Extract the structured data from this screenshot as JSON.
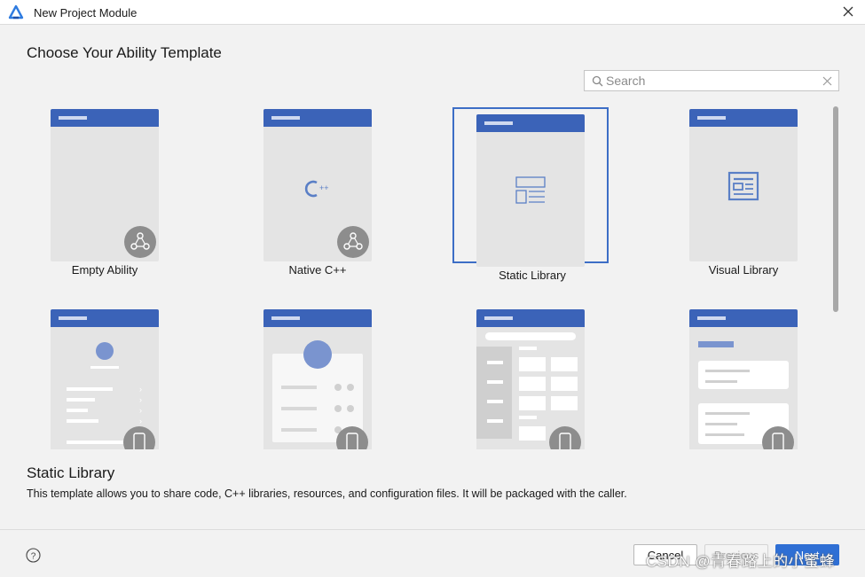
{
  "window": {
    "title": "New Project Module",
    "close_icon": "close-icon"
  },
  "page": {
    "title": "Choose Your Ability Template"
  },
  "search": {
    "value": "",
    "placeholder": "Search",
    "icon": "search-icon",
    "clear_icon": "clear-icon"
  },
  "templates": [
    {
      "label": "Empty Ability",
      "icon": "ability-badge-icon",
      "selected": false
    },
    {
      "label": "Native C++",
      "icon": "cpp-icon",
      "selected": false
    },
    {
      "label": "Static Library",
      "icon": "library-layout-icon",
      "selected": true
    },
    {
      "label": "Visual Library",
      "icon": "visual-card-icon",
      "selected": false
    },
    {
      "label": "",
      "icon": "profile-list-template",
      "selected": false
    },
    {
      "label": "",
      "icon": "avatar-card-template",
      "selected": false
    },
    {
      "label": "",
      "icon": "sidebar-grid-template",
      "selected": false
    },
    {
      "label": "",
      "icon": "card-list-template",
      "selected": false
    }
  ],
  "description": {
    "title": "Static Library",
    "text": "This template allows you to share code, C++ libraries, resources, and configuration files. It will be packaged with the caller."
  },
  "footer": {
    "help_icon": "help-icon",
    "cancel_label": "Cancel",
    "previous_label": "Previous",
    "next_label": "Next"
  },
  "watermark": "CSDN @青春路上的小蜜蜂",
  "colors": {
    "accent": "#3b63b8",
    "selection_border": "#3d6ec6",
    "primary_button": "#2f6fd4"
  }
}
